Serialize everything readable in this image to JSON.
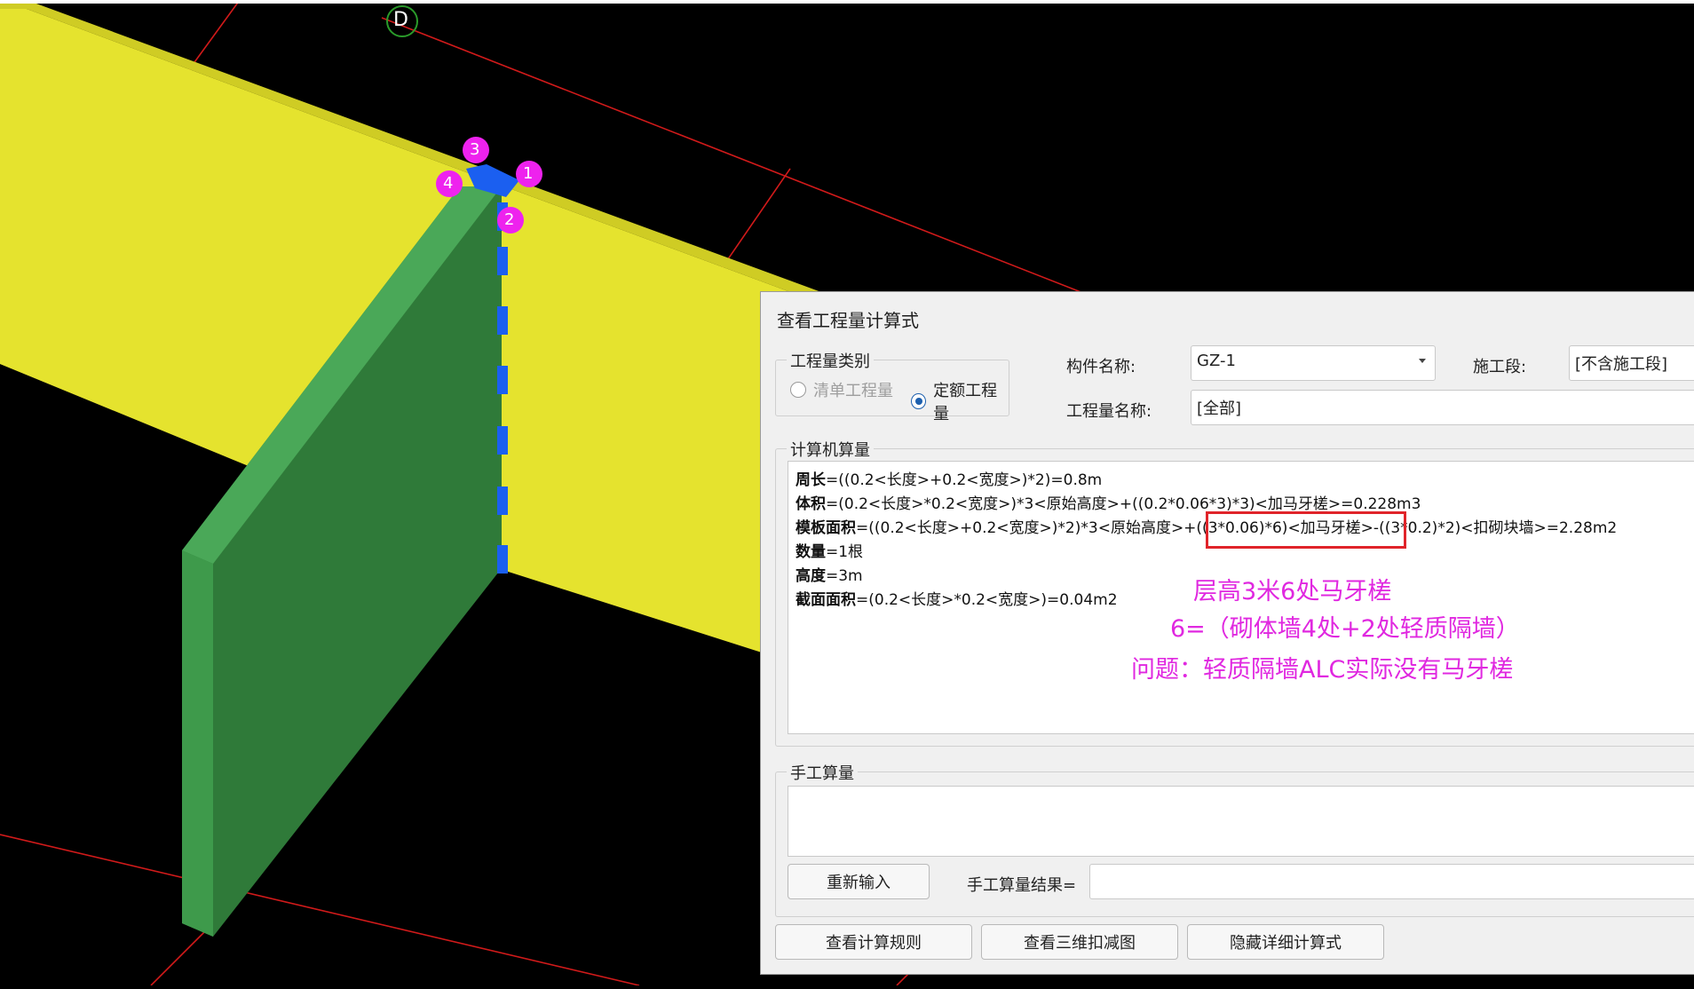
{
  "viewport": {
    "axis_label": "D",
    "markers": [
      "1",
      "2",
      "3",
      "4"
    ],
    "colors": {
      "beam": "#e5e32e",
      "wall": "#3d9a47",
      "column": "#1b5ff0",
      "marker": "#ee22ee",
      "grid": "#d11a1a"
    }
  },
  "dialog": {
    "title": "查看工程量计算式",
    "quantity_type": {
      "label": "工程量类别",
      "options": [
        {
          "label": "清单工程量",
          "checked": false,
          "disabled": true
        },
        {
          "label": "定额工程量",
          "checked": true,
          "disabled": false
        }
      ]
    },
    "component_name_label": "构件名称:",
    "component_name_value": "GZ-1",
    "stage_label": "施工段:",
    "stage_value": "[不含施工段]",
    "quantity_name_label": "工程量名称:",
    "quantity_name_value": "[全部]",
    "computer_calc": {
      "label": "计算机算量",
      "lines": [
        {
          "name": "周长",
          "expr": "=((0.2<长度>+0.2<宽度>)*2)=0.8m"
        },
        {
          "name": "体积",
          "expr": "=(0.2<长度>*0.2<宽度>)*3<原始高度>+((0.2*0.06*3)*3)<加马牙槎>=0.228m3"
        },
        {
          "name": "模板面积",
          "expr": "=((0.2<长度>+0.2<宽度>)*2)*3<原始高度>+((3*0.06)*6)<加马牙槎>-((3*0.2)*2)<扣砌块墙>=2.28m2"
        },
        {
          "name": "数量",
          "expr": "=1根"
        },
        {
          "name": "高度",
          "expr": "=3m"
        },
        {
          "name": "截面面积",
          "expr": "=(0.2<长度>*0.2<宽度>)=0.04m2"
        }
      ]
    },
    "annotations": [
      "层高3米6处马牙槎",
      "6=（砌体墙4处+2处轻质隔墙）",
      "问题：轻质隔墙ALC实际没有马牙槎"
    ],
    "manual_calc": {
      "label": "手工算量",
      "reenter_button": "重新输入",
      "result_label": "手工算量结果="
    },
    "buttons": {
      "view_rules": "查看计算规则",
      "view_3d": "查看三维扣减图",
      "hide_detail": "隐藏详细计算式"
    }
  }
}
